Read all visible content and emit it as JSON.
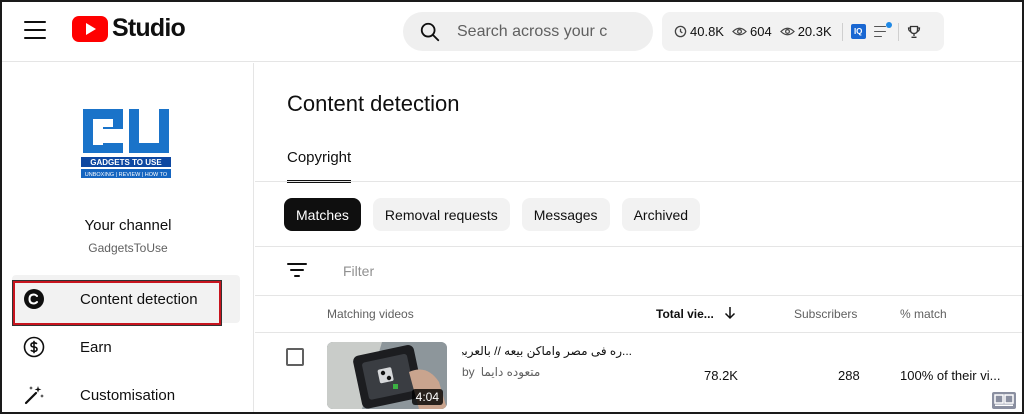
{
  "app": {
    "logo_text": "Studio",
    "brand_color": "#ff0000"
  },
  "search": {
    "placeholder": "Search across your channel",
    "icon": "search-icon"
  },
  "stats": {
    "subscribers": "40.8K",
    "views_icon_value": "604",
    "views_total": "20.3K",
    "iq_label": "IQ",
    "icons": [
      "clock-icon",
      "eye-icon",
      "eye-icon",
      "vidiq-icon",
      "list-icon",
      "trophy-icon"
    ]
  },
  "sidebar": {
    "channel": {
      "title": "Your channel",
      "name": "GadgetsToUse",
      "logo_text": "GTU",
      "logo_caption": "GADGETS TO USE",
      "logo_tagline": "UNBOXING | REVIEW | HOW TO"
    },
    "items": [
      {
        "label": "Content detection",
        "icon": "copyright-icon",
        "active": true
      },
      {
        "label": "Earn",
        "icon": "dollar-icon",
        "active": false
      },
      {
        "label": "Customisation",
        "icon": "magic-wand-icon",
        "active": false
      }
    ],
    "highlight_color": "#c8141e"
  },
  "main": {
    "title": "Content detection",
    "tabs": [
      {
        "label": "Copyright",
        "active": true
      }
    ],
    "chips": [
      {
        "label": "Matches",
        "active": true
      },
      {
        "label": "Removal requests",
        "active": false
      },
      {
        "label": "Messages",
        "active": false
      },
      {
        "label": "Archived",
        "active": false
      }
    ],
    "filter": {
      "placeholder": "Filter"
    },
    "table": {
      "headers": {
        "video": "Matching videos",
        "views": "Total vie...",
        "subscribers": "Subscribers",
        "match": "% match"
      },
      "rows": [
        {
          "title": "...ره فى مصر واماكن بيعه // بالعربى",
          "by_label": "by",
          "channel": "متعوده دايما",
          "duration": "4:04",
          "views": "78.2K",
          "subscribers": "288",
          "match": "100% of their vi..."
        }
      ]
    }
  }
}
